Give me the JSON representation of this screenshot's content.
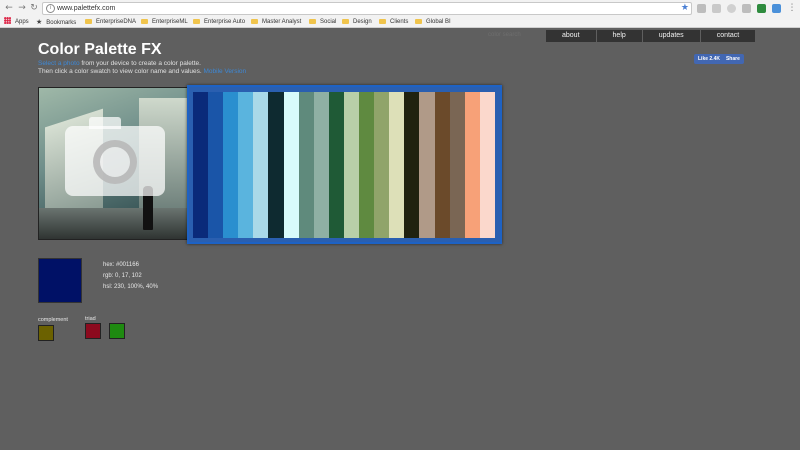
{
  "browser": {
    "url": "www.palettefx.com",
    "bookmarks": [
      "Apps",
      "Bookmarks",
      "EnterpriseDNA",
      "EnterpriseML",
      "Enterprise Auto",
      "Master Analyst",
      "Social",
      "Design",
      "Clients",
      "Global BI"
    ]
  },
  "page": {
    "title": "Color Palette FX",
    "intro_link": "Select a photo",
    "intro_text1": " from your device to create a color palette.",
    "intro_text2": "Then click a color swatch to view color name and values.",
    "mobile_link": "Mobile Version",
    "faded_label": "color search",
    "nav": [
      "about",
      "help",
      "updates",
      "contact"
    ],
    "fb_like": "Like 2.4K",
    "fb_share": "Share"
  },
  "palette": {
    "border_color": "#1e62c4",
    "colors": [
      "#0a2a7a",
      "#1a55a8",
      "#2a8fcf",
      "#5ab4de",
      "#a9d9e8",
      "#0e2a30",
      "#d8fbfb",
      "#5f8a7c",
      "#8fb0a4",
      "#1f5a36",
      "#b8cfa8",
      "#5f8a40",
      "#90a46a",
      "#dde0b8",
      "#20220f",
      "#b09a88",
      "#6b4a2a",
      "#7a6654",
      "#f7a178",
      "#fbd8cc"
    ]
  },
  "selected": {
    "color": "#001166",
    "hex": "hex: #001166",
    "rgb": "rgb: 0, 17, 102",
    "hsl": "hsl: 230, 100%, 40%"
  },
  "harmony": {
    "complement_label": "complement",
    "complement": "#6b6100",
    "triad_label": "triad",
    "triad": [
      "#8c0a1e",
      "#1e8a10"
    ]
  }
}
